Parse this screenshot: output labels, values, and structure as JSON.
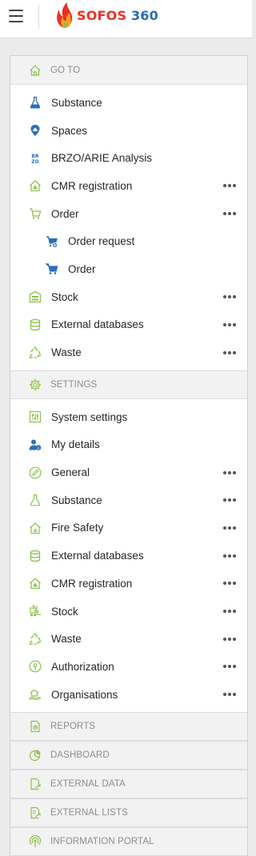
{
  "app": {
    "brand_part1": "SOFOS",
    "brand_part2": " 360"
  },
  "colors": {
    "accent_green": "#8bc34a",
    "accent_blue": "#2b6fb6",
    "brand_red": "#e8312a"
  },
  "goto": {
    "header": "GO TO",
    "header_icon": "home-icon",
    "items": [
      {
        "label": "Substance",
        "icon": "flask-icon",
        "more": false
      },
      {
        "label": "Spaces",
        "icon": "location-pin-icon",
        "more": false
      },
      {
        "label": "BRZO/ARIE Analysis",
        "icon": "brzo-icon",
        "more": false
      },
      {
        "label": "CMR registration",
        "icon": "cmr-house-icon",
        "more": true
      },
      {
        "label": "Order",
        "icon": "cart-icon",
        "more": true
      },
      {
        "label": "Order request",
        "icon": "cart-request-icon",
        "more": false
      },
      {
        "label": "Order",
        "icon": "cart-icon",
        "more": false
      },
      {
        "label": "Stock",
        "icon": "warehouse-icon",
        "more": true
      },
      {
        "label": "External databases",
        "icon": "database-icon",
        "more": true
      },
      {
        "label": "Waste",
        "icon": "recycle-icon",
        "more": true
      }
    ]
  },
  "settings": {
    "header": "SETTINGS",
    "header_icon": "gear-icon",
    "items": [
      {
        "label": "System settings",
        "icon": "sliders-icon",
        "more": false
      },
      {
        "label": "My details",
        "icon": "user-info-icon",
        "more": false
      },
      {
        "label": "General",
        "icon": "pencil-circle-icon",
        "more": true
      },
      {
        "label": "Substance",
        "icon": "flask-outline-icon",
        "more": true
      },
      {
        "label": "Fire Safety",
        "icon": "fire-house-icon",
        "more": true
      },
      {
        "label": "External databases",
        "icon": "database-icon",
        "more": true
      },
      {
        "label": "CMR registration",
        "icon": "cmr-house-icon",
        "more": true
      },
      {
        "label": "Stock",
        "icon": "forklift-icon",
        "more": true
      },
      {
        "label": "Waste",
        "icon": "recycle-icon",
        "more": true
      },
      {
        "label": "Authorization",
        "icon": "lock-icon",
        "more": true
      },
      {
        "label": "Organisations",
        "icon": "organisation-icon",
        "more": true
      }
    ]
  },
  "sections": [
    {
      "label": "REPORTS",
      "icon": "report-icon"
    },
    {
      "label": "DASHBOARD",
      "icon": "pie-chart-icon"
    },
    {
      "label": "EXTERNAL DATA",
      "icon": "external-data-icon"
    },
    {
      "label": "EXTERNAL LISTS",
      "icon": "external-lists-icon"
    },
    {
      "label": "INFORMATION PORTAL",
      "icon": "broadcast-icon"
    }
  ]
}
